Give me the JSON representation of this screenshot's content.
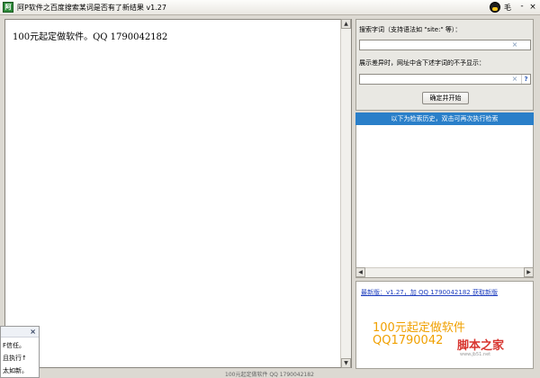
{
  "window": {
    "app_icon": "app-logo-icon",
    "title": "阿P软件之百度搜索某词是否有了新结果  v1.27",
    "minimize_text": "毛",
    "minimize_glyph": "-",
    "close_glyph": "×"
  },
  "main": {
    "content_text": "100元起定做软件。QQ 1790042182"
  },
  "search": {
    "keyword_label": "搜索字词（支持语法如 \"site:\" 等）：",
    "keyword_value": "",
    "exclude_label": "展示差异时，网址中含下述字词的不予显示：",
    "exclude_value": "",
    "clear_glyph": "×",
    "help_glyph": "?",
    "start_button": "确定并开始"
  },
  "history": {
    "header": "以下为检索历史，双击可再次执行检索"
  },
  "info": {
    "new_version": "最新版：v1.27，加 QQ 1790042182 获取新版",
    "ad_line1": "100元起定做软件",
    "ad_line2": "QQ1790042",
    "watermark": "脚本之家",
    "watermark_sub": "www.jb51.net"
  },
  "popup": {
    "close_glyph": "×",
    "line1": "F信任。",
    "line2": "且执行↑",
    "line3": "太如新。"
  },
  "scroll": {
    "up": "▲",
    "down": "▼",
    "left": "◀",
    "right": "▶"
  },
  "status": {
    "text": "100元起定做软件  QQ 1790042182"
  }
}
